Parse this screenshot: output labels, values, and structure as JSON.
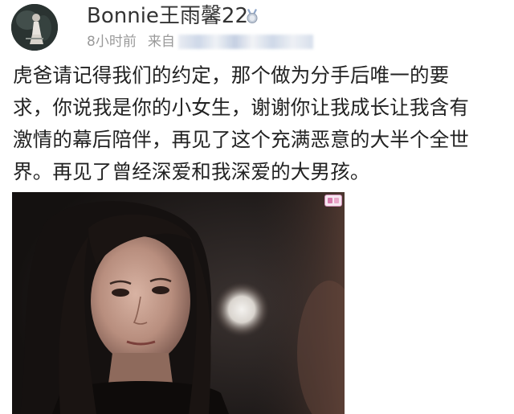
{
  "post": {
    "username": "Bonnie王雨馨22",
    "time": "8小时前",
    "from_label": "来自",
    "text_lines": [
      "虎爸请记得我们的约定，那个做为分手后唯一的要",
      "求，你说我是你的小女生，谢谢你让我成长让我含有",
      "激情的幕后陪伴，再见了这个充满恶意的大半个全世",
      "界。再见了曾经深爱和我深爱的大男孩。"
    ]
  },
  "icons": {
    "avatar": "avatar-photo",
    "level_badge": "silver-medal-icon",
    "image_badge": "gif-badge-icon"
  }
}
